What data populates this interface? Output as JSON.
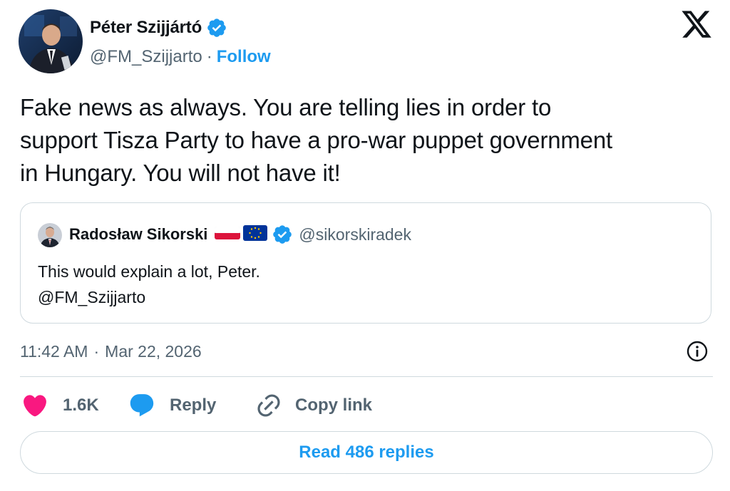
{
  "author": {
    "name": "Péter Szijjártó",
    "handle": "@FM_Szijjarto",
    "separator": "·",
    "follow_label": "Follow",
    "verified_color": "#1d9bf0"
  },
  "brand": {
    "logo_icon": "x-logo-icon"
  },
  "tweet": {
    "lines": [
      "Fake news as always. You are telling lies in order to",
      "support Tisza Party to have a pro-war puppet government",
      "in Hungary. You will not have it!"
    ]
  },
  "quoted_tweet": {
    "name": "Radosław Sikorski",
    "flags": [
      "poland-flag",
      "eu-flag"
    ],
    "handle": "@sikorskiradek",
    "lines": [
      "This would explain a lot, Peter.",
      "@FM_Szijjarto"
    ]
  },
  "meta": {
    "time": "11:42 AM",
    "separator": "·",
    "date": "Mar 22, 2026"
  },
  "actions": {
    "like_count": "1.6K",
    "reply_label": "Reply",
    "copy_label": "Copy link",
    "like_color": "#f91880",
    "reply_color": "#1d9bf0"
  },
  "read_replies_label": "Read 486 replies",
  "colors": {
    "accent": "#1d9bf0",
    "text": "#0f1419",
    "muted": "#536471",
    "border": "#cfd9de"
  }
}
